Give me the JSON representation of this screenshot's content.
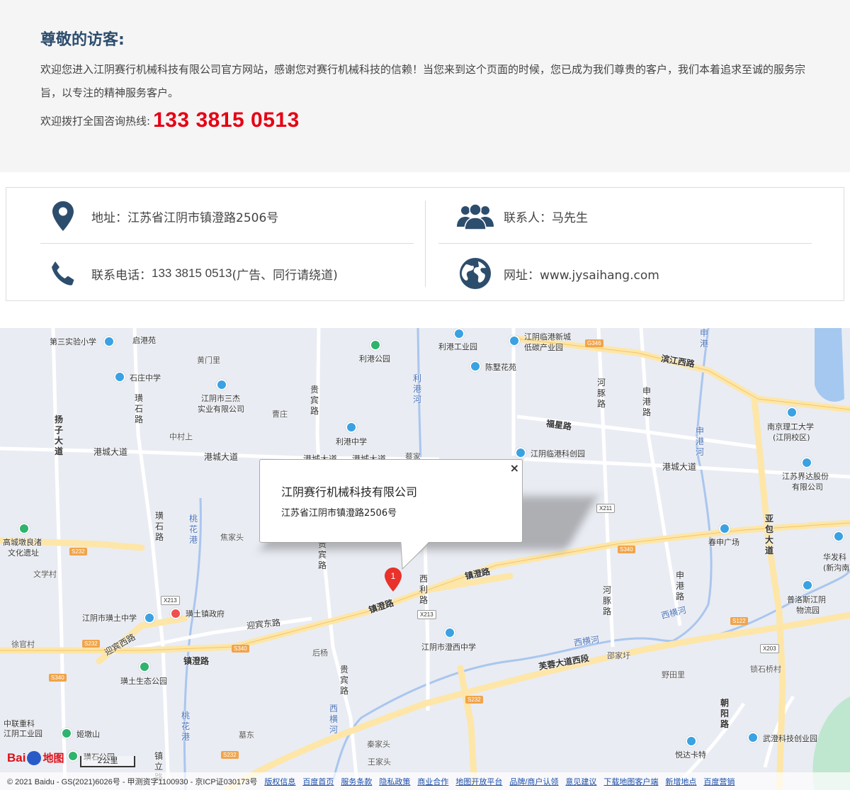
{
  "welcome": {
    "title": "尊敬的访客:",
    "paragraph": "欢迎您进入江阴赛行机械科技有限公司官方网站，感谢您对赛行机械科技的信赖！当您来到这个页面的时候，您已成为我们尊贵的客户，我们本着追求至诚的服务宗旨，以专注的精神服务客户。",
    "hotline_label": "欢迎拨打全国咨询热线:",
    "hotline_number": "133 3815 0513"
  },
  "contact": {
    "address": "地址：江苏省江阴市镇澄路2506号",
    "person": "联系人：马先生",
    "phone_label": "联系电话：",
    "phone_number": "133 3815 0513",
    "phone_note": " (广告、同行请绕道)",
    "website": "网址：www.jysaihang.com"
  },
  "map": {
    "popup": {
      "title": "江阴赛行机械科技有限公司",
      "address": "江苏省江阴市镇澄路2506号",
      "close": "×"
    },
    "marker_label": "1",
    "labels": {
      "l1": "第三实验小学",
      "l2": "启港苑",
      "l3": "黄门里",
      "l4": "利港公园",
      "l5": "利港工业园",
      "l6": "江阴临港新城",
      "l7": "低碳产业园",
      "l8": "陈墅花苑",
      "l9": "石庄中学",
      "l10": "江阴市三杰",
      "l11": "实业有限公司",
      "l12": "曹庄",
      "l13": "利港中学",
      "l14": "中村上",
      "l15": "江阴临港科创园",
      "l16": "南京理工大学",
      "l17": "(江阴校区)",
      "l18": "江苏界达股份",
      "l19": "有限公司",
      "l20": "高城墩良渚",
      "l21": "文化遗址",
      "l22": "焦家头",
      "l23": "春申广场",
      "l24": "华发科",
      "l25": "(新沟南",
      "l26": "文学村",
      "l27": "江阴市璜土中学",
      "l28": "璜土镇政府",
      "l29": "普洛斯江阴",
      "l30": "物流园",
      "l31": "徐官村",
      "l32": "江阴市澄西中学",
      "l33": "后杨",
      "l34": "邵家圩",
      "l35": "野田里",
      "l36": "锁石桥村",
      "l37": "璜土生态公园",
      "l38": "中联重科",
      "l39": "江阴工业园",
      "l40": "姬墩山",
      "l41": "墓东",
      "l42": "璜石公园",
      "l43": "秦家头",
      "l44": "王家头",
      "l45": "悦达卡特",
      "l46": "武澄科技创业园",
      "l47": "蔡家"
    },
    "roads": {
      "r1": "滨江西路",
      "r2": "福星路",
      "r3": "港城大道",
      "r4": "港城大道",
      "r5": "港城大道",
      "r6": "港城大道",
      "r7": "港城大道",
      "r8": "镇澄路",
      "r9": "镇澄路",
      "r10": "镇澄路",
      "r11": "迎宾东路",
      "r12": "迎宾西路",
      "r13": "芙蓉大道西段",
      "r14": "西横河",
      "r15": "西横河",
      "v1": "扬子大道",
      "v2": "璜石路",
      "v3": "璜石路",
      "v4": "桃花港",
      "v5": "桃花港",
      "v6": "贵宾路",
      "v7": "贵宾路",
      "v8": "贵宾路",
      "v9": "西利路",
      "v10": "利港河",
      "v11": "河豚路",
      "v12": "河豚路",
      "v13": "申港路",
      "v14": "申港路",
      "v15": "申港河",
      "v16": "亚包大道",
      "v17": "朝阳路",
      "v18": "西横河",
      "v19": "申港",
      "v20": "镇立路"
    },
    "shields": {
      "s1": "G346",
      "s2": "S232",
      "s3": "X213",
      "s4": "X213",
      "s5": "S232",
      "s6": "S340",
      "s7": "S340",
      "s8": "S340",
      "s9": "S232",
      "s10": "S232",
      "s11": "S122",
      "s12": "X203",
      "s13": "X211",
      "s14": "S232"
    },
    "scale": "2公里",
    "logo_text": "Bai",
    "logo_map": "地图",
    "copyright": "© 2021 Baidu - GS(2021)6026号 - 甲测资字1100930 - 京ICP证030173号",
    "links": [
      "版权信息",
      "百度首页",
      "服务条款",
      "隐私政策",
      "商业合作",
      "地图开放平台",
      "品牌/商户认领",
      "意见建议",
      "下载地图客户端",
      "新增地点",
      "百度营销"
    ]
  },
  "colors": {
    "title": "#2d4d6d",
    "hotline": "#e60012",
    "icon": "#2d4d6d",
    "link": "#1a4ea8"
  }
}
